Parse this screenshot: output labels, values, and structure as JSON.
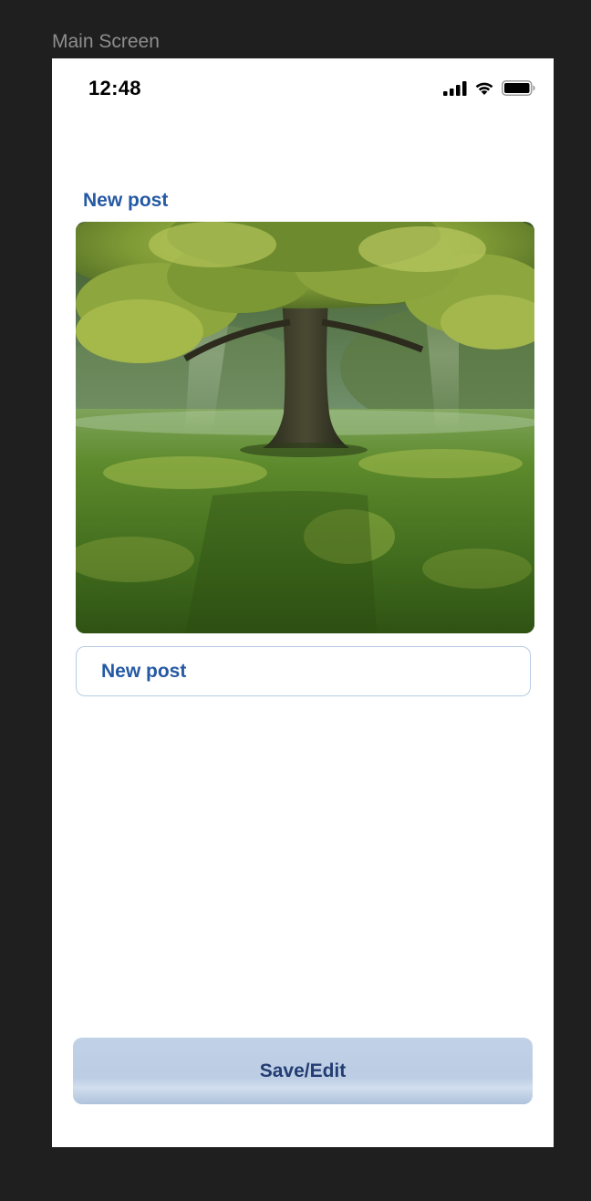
{
  "frame": {
    "label": "Main Screen"
  },
  "status_bar": {
    "time": "12:48",
    "icons": [
      "cellular-signal-icon",
      "wifi-icon",
      "battery-icon"
    ]
  },
  "post": {
    "title": "New post",
    "image": "tree-in-sunlit-meadow",
    "input_value": "New post"
  },
  "actions": {
    "save_label": "Save/Edit"
  },
  "colors": {
    "background": "#1f1f1f",
    "screen": "#ffffff",
    "accent_text": "#2559a3",
    "button_fill": "#bccde4",
    "button_text": "#243e73",
    "input_border": "#b7cce3"
  }
}
